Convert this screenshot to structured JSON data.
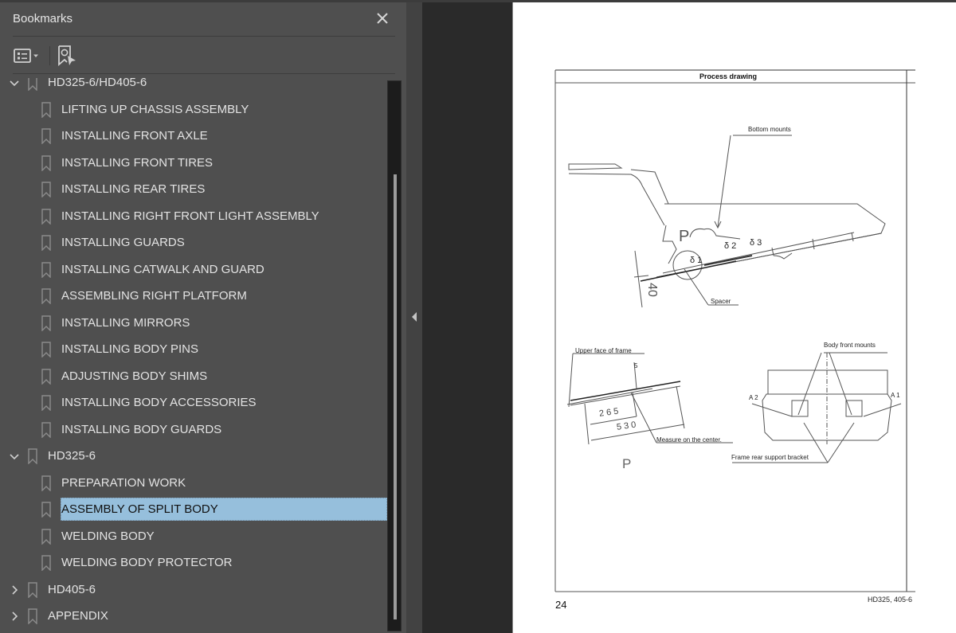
{
  "panel": {
    "title": "Bookmarks",
    "close_icon": "close-icon",
    "options_icon": "bookmark-options-icon",
    "find_icon": "find-current-bookmark-icon"
  },
  "bookmarks": [
    {
      "label": "HD325-6/HD405-6",
      "level": 0,
      "expanded": true,
      "partially_visible": true
    },
    {
      "label": "LIFTING UP CHASSIS ASSEMBLY",
      "level": 1
    },
    {
      "label": "INSTALLING FRONT AXLE",
      "level": 1
    },
    {
      "label": "INSTALLING FRONT TIRES",
      "level": 1
    },
    {
      "label": "INSTALLING REAR TIRES",
      "level": 1
    },
    {
      "label": "INSTALLING RIGHT FRONT LIGHT ASSEMBLY",
      "level": 1
    },
    {
      "label": "INSTALLING GUARDS",
      "level": 1
    },
    {
      "label": "INSTALLING CATWALK AND GUARD",
      "level": 1
    },
    {
      "label": "ASSEMBLING RIGHT PLATFORM",
      "level": 1
    },
    {
      "label": "INSTALLING MIRRORS",
      "level": 1
    },
    {
      "label": "INSTALLING BODY PINS",
      "level": 1
    },
    {
      "label": "ADJUSTING BODY SHIMS",
      "level": 1
    },
    {
      "label": "INSTALLING BODY ACCESSORIES",
      "level": 1
    },
    {
      "label": "INSTALLING BODY GUARDS",
      "level": 1
    },
    {
      "label": "HD325-6",
      "level": 0,
      "expanded": true
    },
    {
      "label": "PREPARATION WORK",
      "level": 1
    },
    {
      "label": "ASSEMBLY OF SPLIT BODY",
      "level": 1,
      "selected": true
    },
    {
      "label": "WELDING BODY",
      "level": 1
    },
    {
      "label": "WELDING BODY PROTECTOR",
      "level": 1
    },
    {
      "label": "HD405-6",
      "level": 0,
      "expanded": false
    },
    {
      "label": "APPENDIX",
      "level": 0,
      "expanded": false
    }
  ],
  "scrollbar": {
    "thumb_start_fraction": 0.17,
    "thumb_end_fraction": 0.98
  },
  "colors": {
    "panel_bg": "#4f4f4f",
    "selection_bg": "#96bfdc",
    "viewer_bg": "#2a2a2a",
    "text": "#e3e3e3"
  },
  "document_page": {
    "header": "Process drawing",
    "labels": {
      "bottom_mounts": "Bottom mounts",
      "spacer": "Spacer",
      "p_mark": "P",
      "delta1": "δ 1",
      "delta2": "δ 2",
      "delta3": "δ 3",
      "dim_40": "40",
      "upper_face_of_frame": "Upper face of frame",
      "dim_265": "265",
      "dim_530": "530",
      "dim_5": "5",
      "measure_on_center": "Measure on the center.",
      "view_p": "P",
      "body_front_mounts": "Body front mounts",
      "a2": "A 2",
      "a1": "A 1",
      "frame_rear_support_bracket": "Frame rear support bracket"
    },
    "page_number": "24",
    "model_code": "HD325, 405-6"
  }
}
